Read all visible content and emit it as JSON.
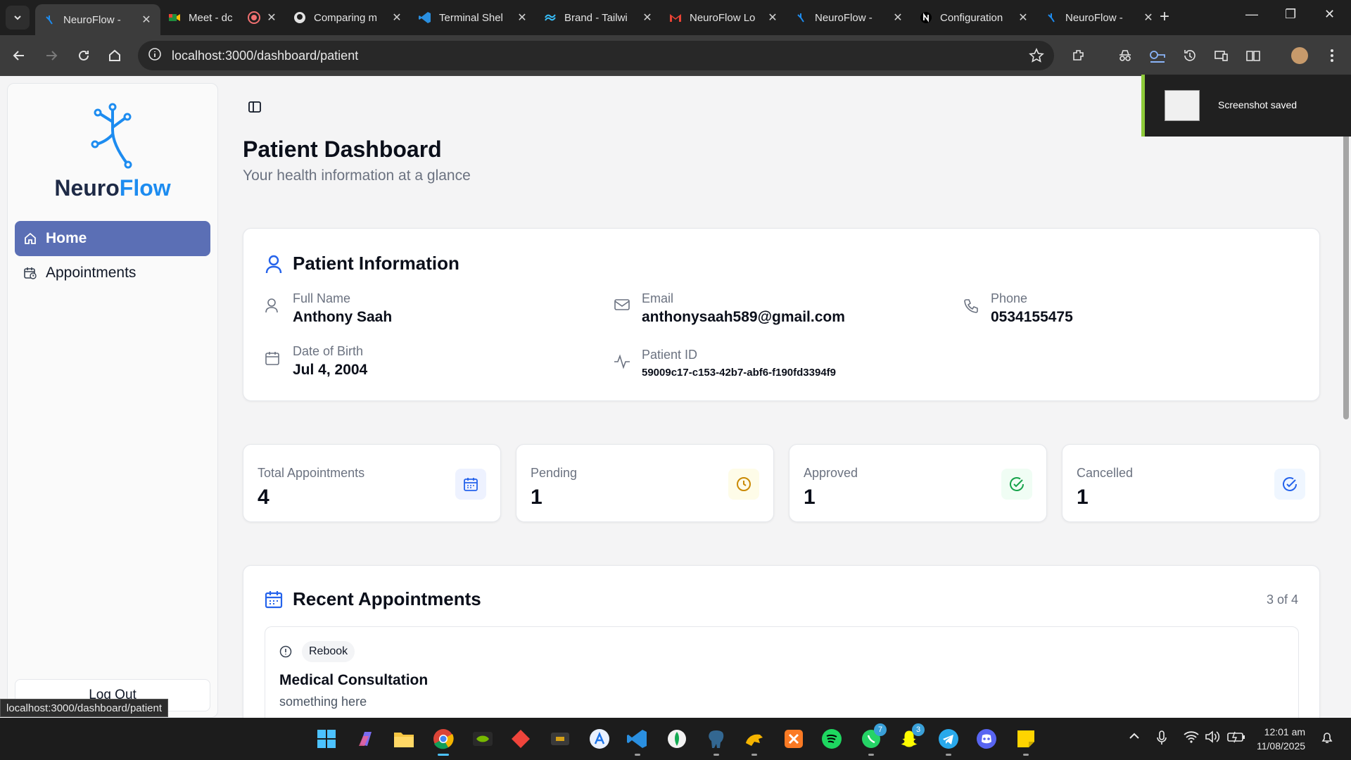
{
  "browser": {
    "tabs": [
      {
        "title": "NeuroFlow - ",
        "favicon": "neuroflow-icon",
        "active": true
      },
      {
        "title": "Meet - dc",
        "favicon": "meet-icon",
        "active": false
      },
      {
        "title": "Comparing m",
        "favicon": "github-icon",
        "active": false
      },
      {
        "title": "Terminal Shel",
        "favicon": "vscode-icon",
        "active": false
      },
      {
        "title": "Brand - Tailwi",
        "favicon": "tailwind-icon",
        "active": false
      },
      {
        "title": "NeuroFlow Lo",
        "favicon": "gmail-icon",
        "active": false
      },
      {
        "title": "NeuroFlow - ",
        "favicon": "neuroflow-icon",
        "active": false
      },
      {
        "title": "Configuration",
        "favicon": "notion-icon",
        "active": false
      },
      {
        "title": "NeuroFlow - ",
        "favicon": "neuroflow-icon",
        "active": false
      }
    ],
    "url": "localhost:3000/dashboard/patient",
    "status_url": "localhost:3000/dashboard/patient"
  },
  "sidebar": {
    "brand_part1": "Neuro",
    "brand_part2": "Flow",
    "items": [
      {
        "label": "Home",
        "icon": "home-icon",
        "active": true
      },
      {
        "label": "Appointments",
        "icon": "calendar-clock-icon",
        "active": false
      }
    ],
    "logout_label": "Log Out"
  },
  "header": {
    "title": "Patient Dashboard",
    "subtitle": "Your health information at a glance"
  },
  "patient_info": {
    "heading": "Patient Information",
    "full_name_label": "Full Name",
    "full_name": "Anthony Saah",
    "email_label": "Email",
    "email": "anthonysaah589@gmail.com",
    "phone_label": "Phone",
    "phone": "0534155475",
    "dob_label": "Date of Birth",
    "dob": "Jul 4, 2004",
    "patient_id_label": "Patient ID",
    "patient_id": "59009c17-c153-42b7-abf6-f190fd3394f9"
  },
  "stats": [
    {
      "label": "Total Appointments",
      "value": "4",
      "icon": "calendar-icon",
      "color": "#2563eb",
      "bg": "#eef2ff"
    },
    {
      "label": "Pending",
      "value": "1",
      "icon": "clock-icon",
      "color": "#ca8a04",
      "bg": "#fefce8"
    },
    {
      "label": "Approved",
      "value": "1",
      "icon": "check-circle-icon",
      "color": "#16a34a",
      "bg": "#f0fdf4"
    },
    {
      "label": "Cancelled",
      "value": "1",
      "icon": "check-circle-icon",
      "color": "#2563eb",
      "bg": "#eff6ff"
    }
  ],
  "recent": {
    "heading": "Recent Appointments",
    "count": "3 of 4",
    "items": [
      {
        "badge": "Rebook",
        "title": "Medical Consultation",
        "description": "something here"
      }
    ]
  },
  "toast": {
    "message": "Screenshot saved"
  },
  "taskbar": {
    "time": "12:01 am",
    "date": "11/08/2025",
    "badges": {
      "whatsapp": "7",
      "snapchat": "3"
    }
  },
  "colors": {
    "brand_dark": "#1e2a46",
    "brand_blue": "#1d8cf0",
    "nav_active": "#5b6fb5"
  }
}
